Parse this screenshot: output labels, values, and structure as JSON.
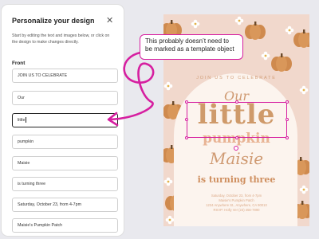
{
  "panel": {
    "title": "Personalize your design",
    "close_icon": "✕",
    "instructions": "Start by editing the text and images below, or click on the design to make changes directly.",
    "section_label": "Front",
    "fields": [
      {
        "value": "JOIN US TO CELEBRATE"
      },
      {
        "value": "Our"
      },
      {
        "value": "little",
        "active": true
      },
      {
        "value": "pumpkin"
      },
      {
        "value": "Maisie"
      },
      {
        "value": "is turning three"
      },
      {
        "value": "Saturday, October 23, from 4-7pm"
      },
      {
        "value": "Maisie's Pumpkin Patch"
      }
    ]
  },
  "card": {
    "join": "JOIN US TO CELEBRATE",
    "our": "Our",
    "little": "little",
    "pumpkin": "pumpkin",
    "name": "Maisie",
    "turning": "is turning three",
    "details_line1": "Saturday, October 23, from 4-7pm",
    "details_line2": "Maisie's Pumpkin Patch",
    "details_line3": "1234 Anywhere St., Anywhere, CA 90010",
    "details_line4": "RSVP: Holly Ver (23) 456-7890"
  },
  "callout": {
    "text": "This probably doesn’t need to be marked as a template object"
  },
  "colors": {
    "accent": "#d61fa0",
    "card_bg": "#f1d8cc",
    "pumpkin": "#cf8a4e"
  }
}
